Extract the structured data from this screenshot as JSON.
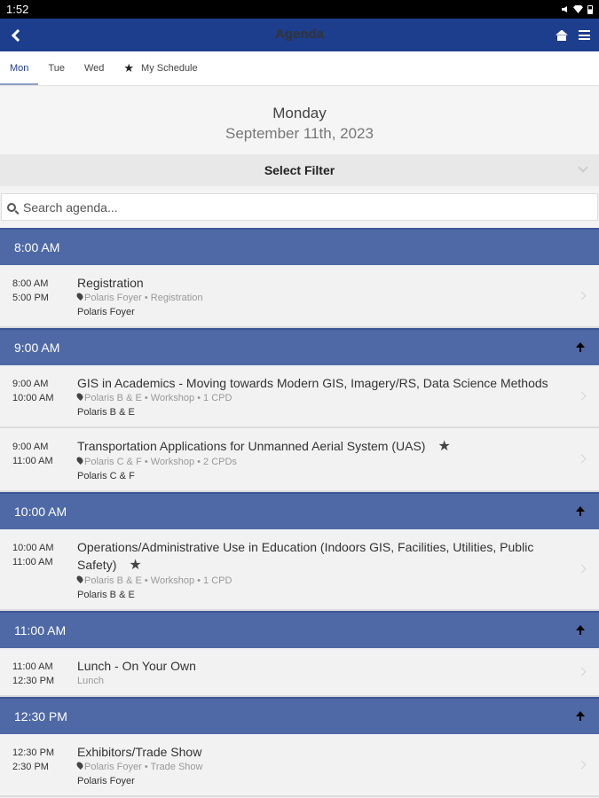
{
  "status": {
    "time": "1:52"
  },
  "header": {
    "title": "Agenda"
  },
  "tabs": [
    "Mon",
    "Tue",
    "Wed",
    "My Schedule"
  ],
  "day": {
    "name": "Monday",
    "date": "September 11th, 2023"
  },
  "filter": {
    "label": "Select Filter"
  },
  "search": {
    "placeholder": "Search agenda..."
  },
  "groups": [
    {
      "time": "8:00 AM",
      "sessions": [
        {
          "start": "8:00 AM",
          "end": "5:00 PM",
          "title": "Registration",
          "meta": "Polaris Foyer • Registration",
          "room": "Polaris Foyer"
        }
      ]
    },
    {
      "time": "9:00 AM",
      "sessions": [
        {
          "start": "9:00 AM",
          "end": "10:00 AM",
          "title": "GIS in Academics - Moving towards Modern GIS, Imagery/RS, Data Science Methods",
          "meta": "Polaris B & E • Workshop • 1 CPD",
          "room": "Polaris B & E"
        },
        {
          "start": "9:00 AM",
          "end": "11:00 AM",
          "title": "Transportation Applications for Unmanned Aerial System (UAS)",
          "meta": "Polaris C & F • Workshop • 2 CPDs",
          "room": "Polaris C & F"
        }
      ]
    },
    {
      "time": "10:00 AM",
      "sessions": [
        {
          "start": "10:00 AM",
          "end": "11:00 AM",
          "title": "Operations/Administrative Use in Education (Indoors GIS, Facilities, Utilities, Public Safety)",
          "meta": "Polaris B & E • Workshop • 1 CPD",
          "room": "Polaris B & E"
        }
      ]
    },
    {
      "time": "11:00 AM",
      "sessions": [
        {
          "start": "11:00 AM",
          "end": "12:30 PM",
          "title": "Lunch - On Your Own",
          "meta": "Lunch",
          "room": ""
        }
      ]
    },
    {
      "time": "12:30 PM",
      "sessions": [
        {
          "start": "12:30 PM",
          "end": "2:30 PM",
          "title": "Exhibitors/Trade Show",
          "meta": "Polaris Foyer • Trade Show",
          "room": "Polaris Foyer"
        }
      ]
    }
  ]
}
